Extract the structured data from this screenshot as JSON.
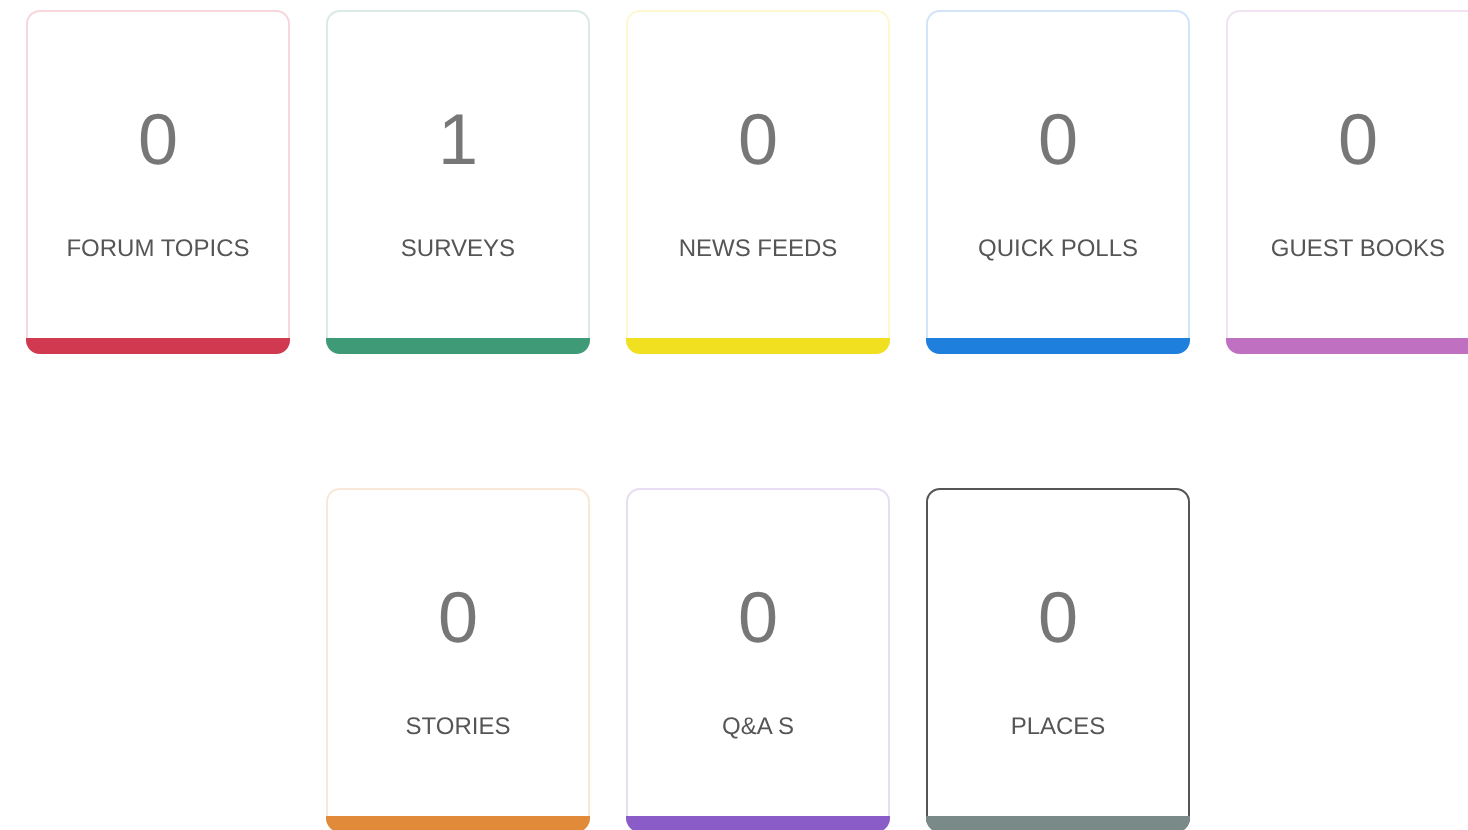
{
  "rows": [
    {
      "cards": [
        {
          "count": "0",
          "label": "FORUM TOPICS",
          "color": "#d0394f",
          "selected": false
        },
        {
          "count": "1",
          "label": "SURVEYS",
          "color": "#3f9a78",
          "selected": false
        },
        {
          "count": "0",
          "label": "NEWS FEEDS",
          "color": "#f0e020",
          "selected": false
        },
        {
          "count": "0",
          "label": "QUICK POLLS",
          "color": "#1e7fdc",
          "selected": false
        },
        {
          "count": "0",
          "label": "GUEST BOOKS",
          "color": "#c070c0",
          "selected": false
        }
      ]
    },
    {
      "cards": [
        {
          "count": "0",
          "label": "STORIES",
          "color": "#e08a3a",
          "selected": false
        },
        {
          "count": "0",
          "label": "Q&A S",
          "color": "#8a5cc8",
          "selected": false
        },
        {
          "count": "0",
          "label": "PLACES",
          "color": "#7a8a88",
          "selected": true
        }
      ]
    }
  ]
}
